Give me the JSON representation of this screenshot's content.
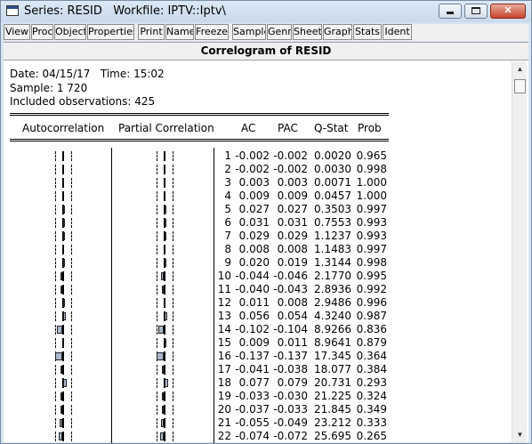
{
  "window": {
    "title": "Series: RESID   Workfile: IPTV::Iptv\\",
    "close_label": "✕"
  },
  "toolbar": {
    "buttons": [
      "View",
      "Proc",
      "Object",
      "Properties",
      "Print",
      "Name",
      "Freeze",
      "Sample",
      "Genr",
      "Sheet",
      "Graph",
      "Stats",
      "Ident"
    ]
  },
  "view": {
    "title": "Correlogram of RESID",
    "date_line": "Date: 04/15/17   Time: 15:02",
    "sample_line": "Sample: 1 720",
    "obs_line": "Included observations: 425"
  },
  "table": {
    "headers": {
      "autocorrelation": "Autocorrelation",
      "partial": "Partial Correlation",
      "ac": "AC",
      "pac": "PAC",
      "qstat": "Q-Stat",
      "prob": "Prob"
    },
    "rows": [
      {
        "lag": "1",
        "ac": "-0.002",
        "pac": "-0.002",
        "q": "0.0020",
        "p": "0.965",
        "acv": -0.002,
        "pacv": -0.002
      },
      {
        "lag": "2",
        "ac": "-0.002",
        "pac": "-0.002",
        "q": "0.0030",
        "p": "0.998",
        "acv": -0.002,
        "pacv": -0.002
      },
      {
        "lag": "3",
        "ac": "0.003",
        "pac": "0.003",
        "q": "0.0071",
        "p": "1.000",
        "acv": 0.003,
        "pacv": 0.003
      },
      {
        "lag": "4",
        "ac": "0.009",
        "pac": "0.009",
        "q": "0.0457",
        "p": "1.000",
        "acv": 0.009,
        "pacv": 0.009
      },
      {
        "lag": "5",
        "ac": "0.027",
        "pac": "0.027",
        "q": "0.3503",
        "p": "0.997",
        "acv": 0.027,
        "pacv": 0.027
      },
      {
        "lag": "6",
        "ac": "0.031",
        "pac": "0.031",
        "q": "0.7553",
        "p": "0.993",
        "acv": 0.031,
        "pacv": 0.031
      },
      {
        "lag": "7",
        "ac": "0.029",
        "pac": "0.029",
        "q": "1.1237",
        "p": "0.993",
        "acv": 0.029,
        "pacv": 0.029
      },
      {
        "lag": "8",
        "ac": "0.008",
        "pac": "0.008",
        "q": "1.1483",
        "p": "0.997",
        "acv": 0.008,
        "pacv": 0.008
      },
      {
        "lag": "9",
        "ac": "0.020",
        "pac": "0.019",
        "q": "1.3144",
        "p": "0.998",
        "acv": 0.02,
        "pacv": 0.019
      },
      {
        "lag": "10",
        "ac": "-0.044",
        "pac": "-0.046",
        "q": "2.1770",
        "p": "0.995",
        "acv": -0.044,
        "pacv": -0.046
      },
      {
        "lag": "11",
        "ac": "-0.040",
        "pac": "-0.043",
        "q": "2.8936",
        "p": "0.992",
        "acv": -0.04,
        "pacv": -0.043
      },
      {
        "lag": "12",
        "ac": "0.011",
        "pac": "0.008",
        "q": "2.9486",
        "p": "0.996",
        "acv": 0.011,
        "pacv": 0.008
      },
      {
        "lag": "13",
        "ac": "0.056",
        "pac": "0.054",
        "q": "4.3240",
        "p": "0.987",
        "acv": 0.056,
        "pacv": 0.054
      },
      {
        "lag": "14",
        "ac": "-0.102",
        "pac": "-0.104",
        "q": "8.9266",
        "p": "0.836",
        "acv": -0.102,
        "pacv": -0.104
      },
      {
        "lag": "15",
        "ac": "0.009",
        "pac": "0.011",
        "q": "8.9641",
        "p": "0.879",
        "acv": 0.009,
        "pacv": 0.011
      },
      {
        "lag": "16",
        "ac": "-0.137",
        "pac": "-0.137",
        "q": "17.345",
        "p": "0.364",
        "acv": -0.137,
        "pacv": -0.137
      },
      {
        "lag": "17",
        "ac": "-0.041",
        "pac": "-0.038",
        "q": "18.077",
        "p": "0.384",
        "acv": -0.041,
        "pacv": -0.038
      },
      {
        "lag": "18",
        "ac": "0.077",
        "pac": "0.079",
        "q": "20.731",
        "p": "0.293",
        "acv": 0.077,
        "pacv": 0.079
      },
      {
        "lag": "19",
        "ac": "-0.033",
        "pac": "-0.030",
        "q": "21.225",
        "p": "0.324",
        "acv": -0.033,
        "pacv": -0.03
      },
      {
        "lag": "20",
        "ac": "-0.037",
        "pac": "-0.033",
        "q": "21.845",
        "p": "0.349",
        "acv": -0.037,
        "pacv": -0.033
      },
      {
        "lag": "21",
        "ac": "-0.055",
        "pac": "-0.049",
        "q": "23.212",
        "p": "0.333",
        "acv": -0.055,
        "pacv": -0.049
      },
      {
        "lag": "22",
        "ac": "-0.074",
        "pac": "-0.072",
        "q": "25.695",
        "p": "0.265",
        "acv": -0.074,
        "pacv": -0.072
      }
    ]
  }
}
